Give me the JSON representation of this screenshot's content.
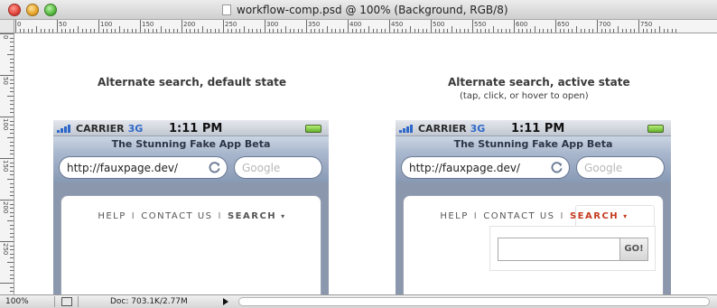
{
  "window": {
    "title": "workflow-comp.psd @ 100% (Background, RGB/8)",
    "ruler_numbers": [
      "0",
      "50",
      "100",
      "150",
      "200",
      "250",
      "300",
      "350",
      "400",
      "450",
      "500",
      "550",
      "600",
      "650",
      "700",
      "750"
    ],
    "ruler_numbers_left": [
      "0",
      "50",
      "100",
      "150",
      "200",
      "250"
    ]
  },
  "canvas": {
    "left_heading": "Alternate search, default state",
    "right_heading": "Alternate search, active state",
    "right_subheading": "(tap, click, or hover to open)"
  },
  "phone": {
    "carrier": "CARRIER",
    "network": "3G",
    "time": "1:11 PM",
    "app_title": "The Stunning Fake App Beta",
    "url": "http://fauxpage.dev/",
    "search_placeholder": "Google",
    "nav": {
      "help": "HELP",
      "separator": "I",
      "contact": "CONTACT US",
      "search": "SEARCH",
      "caret": "▾"
    },
    "go_button": "GO!"
  },
  "colors": {
    "search_active": "#c53a1e",
    "network_blue": "#2e69c9"
  },
  "statusbar": {
    "zoom": "100%",
    "doc": "Doc: 703.1K/2.77M"
  }
}
